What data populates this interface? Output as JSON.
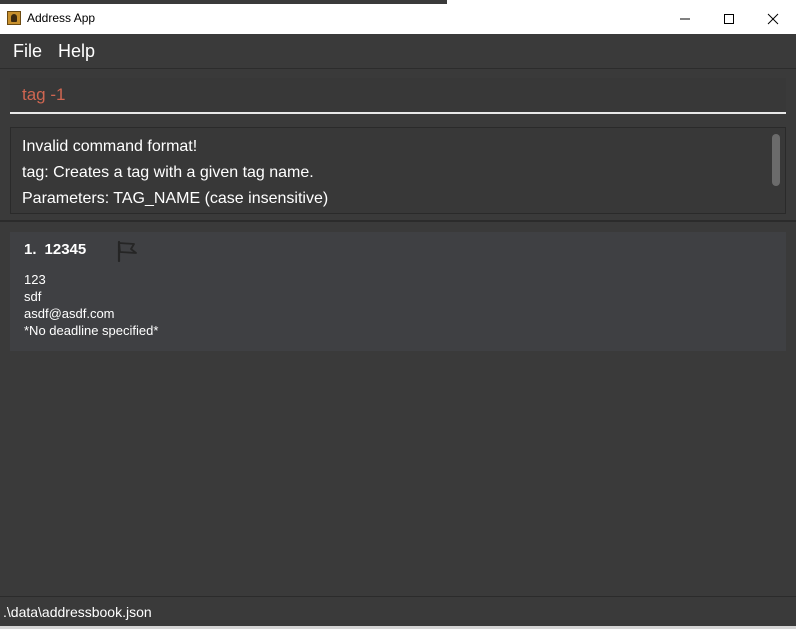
{
  "window": {
    "title": "Address App",
    "controls": {
      "minimize": "minimize-icon",
      "maximize": "maximize-icon",
      "close": "close-icon"
    }
  },
  "menu": {
    "items": [
      {
        "label": "File"
      },
      {
        "label": "Help"
      }
    ]
  },
  "command_box": {
    "value": "tag -1",
    "text_color": "#d06651"
  },
  "result_display": {
    "lines": [
      "Invalid command format!",
      "tag: Creates a tag with a given tag name.",
      "Parameters: TAG_NAME (case insensitive)"
    ]
  },
  "person_list": {
    "cards": [
      {
        "index": "1.",
        "name": "12345",
        "icon": "flag-icon",
        "phone": "123",
        "address": "sdf",
        "email": "asdf@asdf.com",
        "deadline": "*No deadline specified*"
      }
    ]
  },
  "status_bar": {
    "path": ".\\data\\addressbook.json"
  },
  "colors": {
    "background": "#3a3a3a",
    "card": "#3f4043",
    "error_text": "#d06651"
  }
}
